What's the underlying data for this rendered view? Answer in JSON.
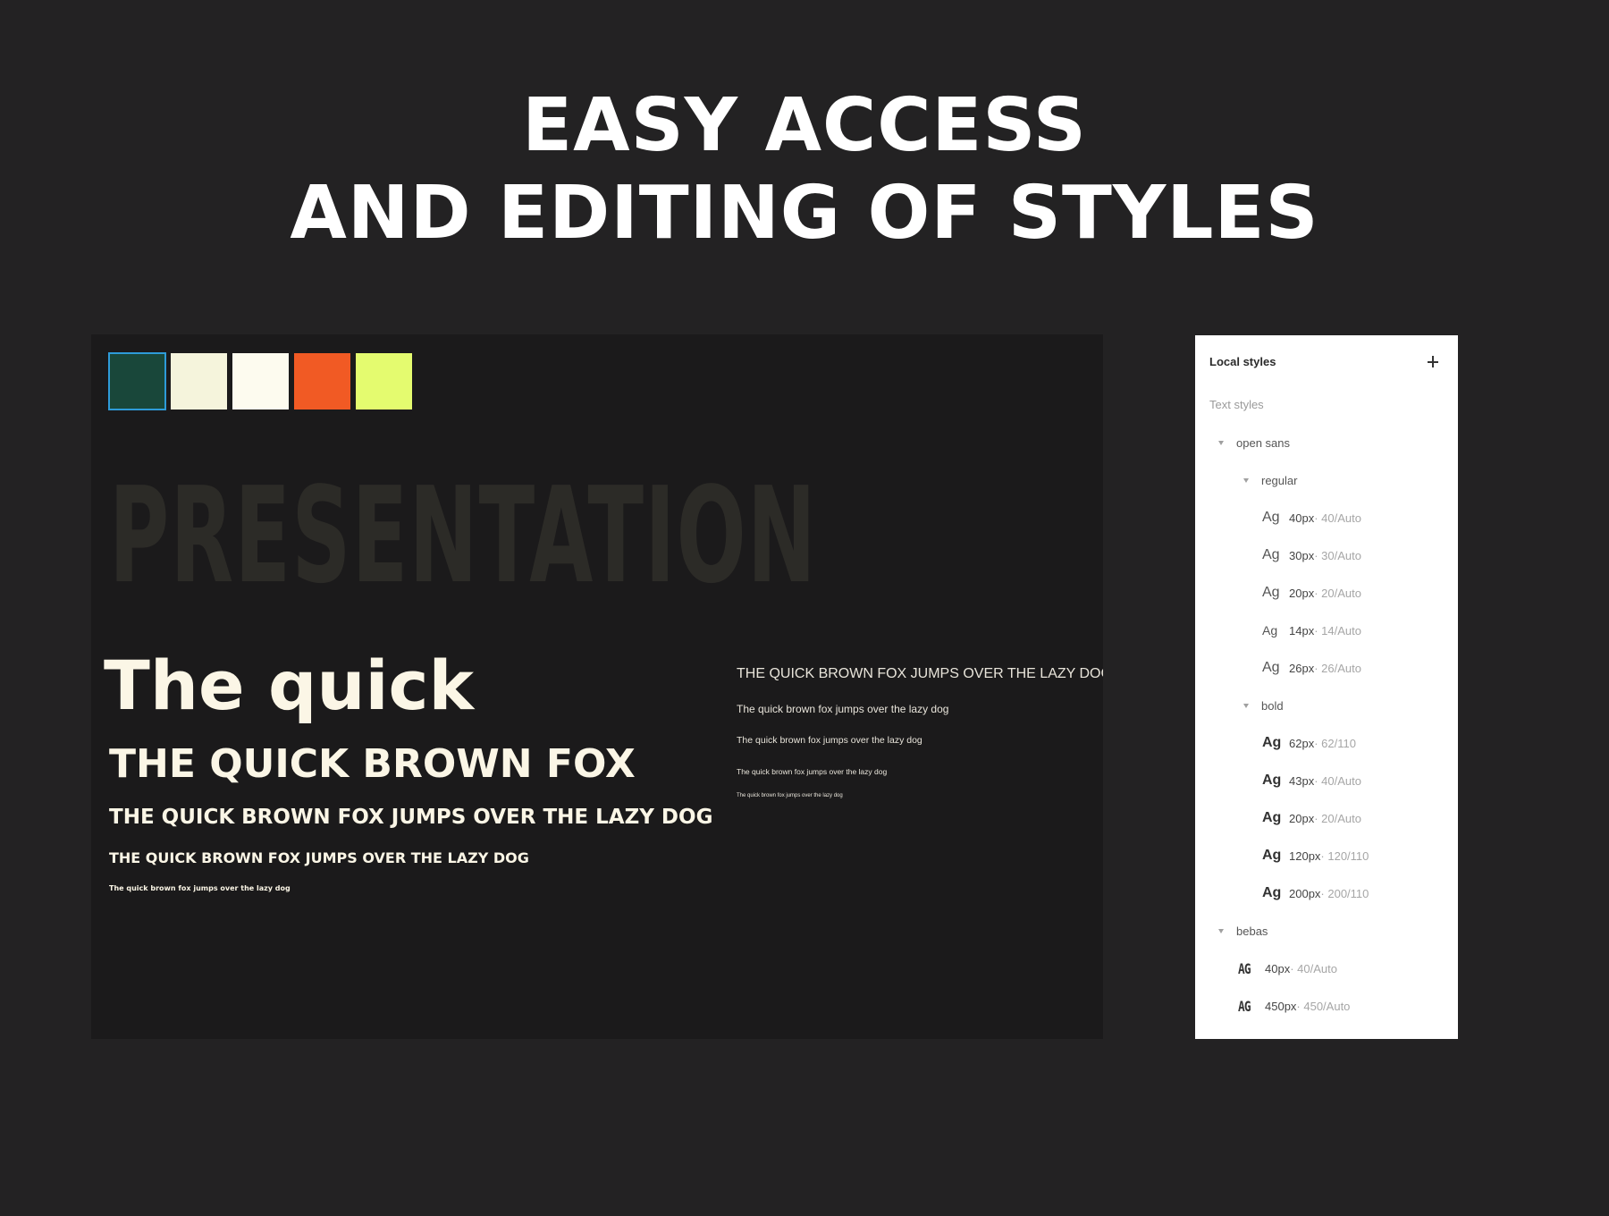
{
  "hero": {
    "line1": "EASY ACCESS",
    "line2": "AND EDITING OF STYLES"
  },
  "canvas": {
    "swatches": [
      {
        "color": "#19473a",
        "selected": true
      },
      {
        "color": "#f5f4dc",
        "selected": false
      },
      {
        "color": "#fdfbef",
        "selected": false
      },
      {
        "color": "#f15a24",
        "selected": false
      },
      {
        "color": "#e4fb6f",
        "selected": false
      }
    ],
    "presentation": "PRESENTATION",
    "left_samples": [
      "The quick",
      "THE QUICK BROWN FOX",
      "THE QUICK BROWN FOX JUMPS OVER THE LAZY DOG",
      "THE QUICK BROWN FOX JUMPS OVER THE LAZY DOG",
      "The quick brown fox jumps over the lazy dog"
    ],
    "right_samples": [
      "THE QUICK BROWN FOX JUMPS OVER THE LAZY DOG",
      "The quick brown fox jumps over the lazy dog",
      "The quick brown fox jumps over the lazy dog",
      "The quick brown fox jumps over the lazy dog",
      "The quick brown fox jumps over the lazy dog"
    ]
  },
  "panel": {
    "title": "Local styles",
    "section": "Text styles",
    "groups": [
      {
        "name": "open sans",
        "subgroups": [
          {
            "name": "regular",
            "styles": [
              {
                "glyph": "Ag",
                "size": "40px",
                "meta": " · 40/Auto"
              },
              {
                "glyph": "Ag",
                "size": "30px",
                "meta": " · 30/Auto"
              },
              {
                "glyph": "Ag",
                "size": "20px",
                "meta": " · 20/Auto"
              },
              {
                "glyph": "Ag",
                "size": "14px",
                "meta": " · 14/Auto"
              },
              {
                "glyph": "Ag",
                "size": "26px",
                "meta": " · 26/Auto"
              }
            ]
          },
          {
            "name": "bold",
            "styles": [
              {
                "glyph": "Ag",
                "size": "62px",
                "meta": " · 62/110"
              },
              {
                "glyph": "Ag",
                "size": "43px",
                "meta": " · 40/Auto"
              },
              {
                "glyph": "Ag",
                "size": "20px",
                "meta": " · 20/Auto"
              },
              {
                "glyph": "Ag",
                "size": "120px",
                "meta": " · 120/110"
              },
              {
                "glyph": "Ag",
                "size": "200px",
                "meta": " · 200/110"
              }
            ]
          }
        ]
      },
      {
        "name": "bebas",
        "styles": [
          {
            "glyph": "AG",
            "size": "40px",
            "meta": " · 40/Auto"
          },
          {
            "glyph": "AG",
            "size": "450px",
            "meta": " · 450/Auto"
          }
        ]
      }
    ]
  }
}
